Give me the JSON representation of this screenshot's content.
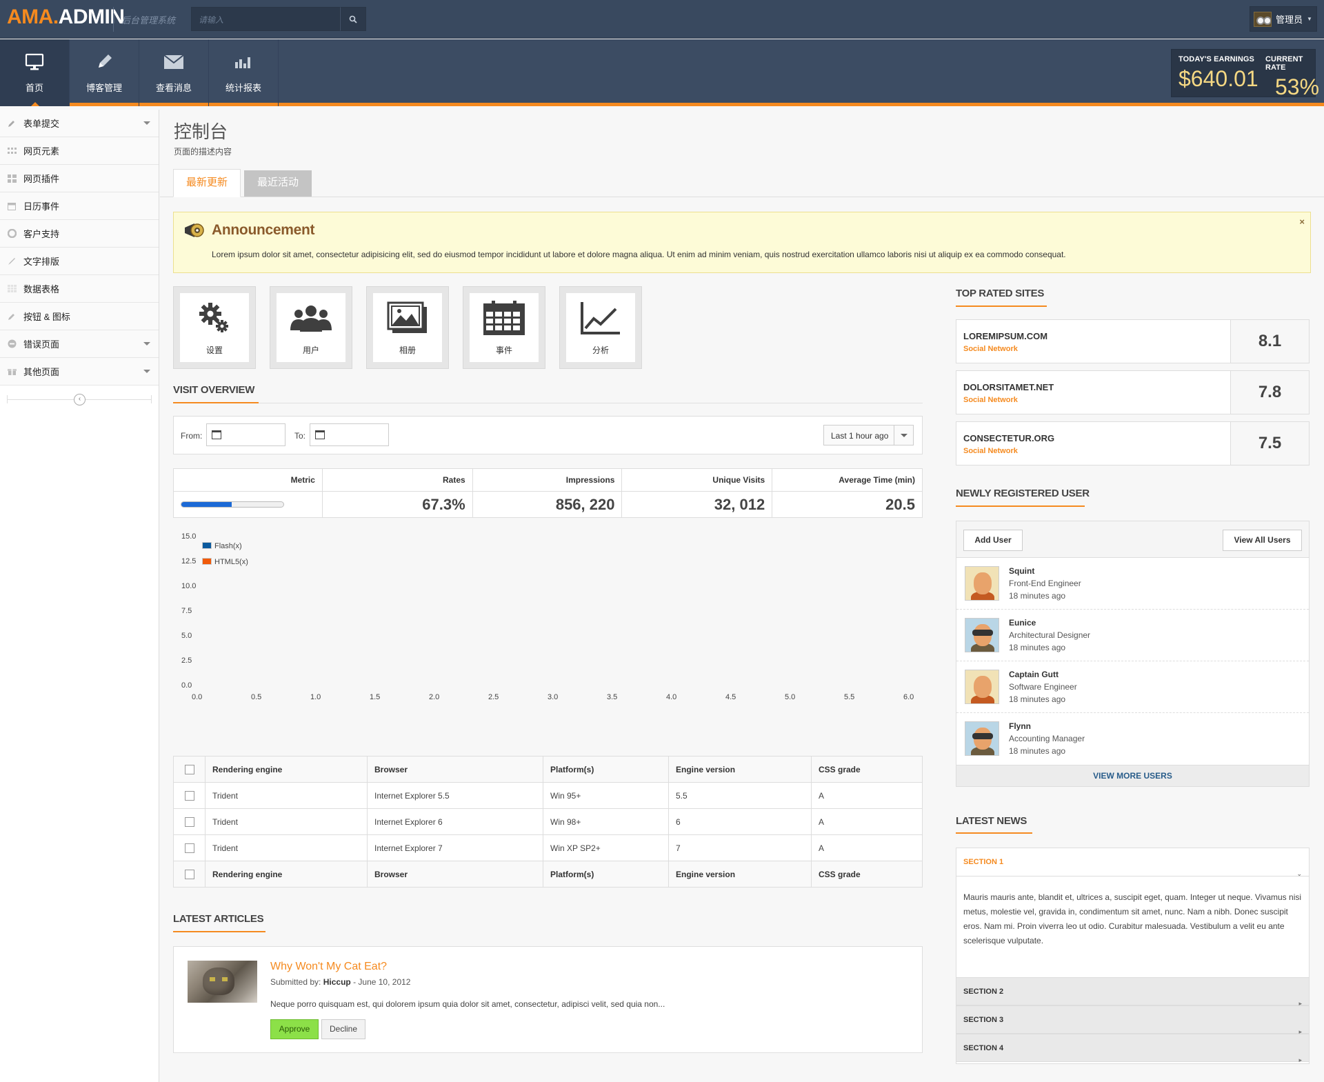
{
  "header": {
    "logo_part1": "AMA.",
    "logo_part2": "ADMIN",
    "tagline": "后台管理系统",
    "search_placeholder": "请输入",
    "user_name": "管理员"
  },
  "nav": {
    "items": [
      {
        "label": "首页",
        "icon": "monitor-icon"
      },
      {
        "label": "博客管理",
        "icon": "pencil-icon"
      },
      {
        "label": "查看消息",
        "icon": "envelope-icon"
      },
      {
        "label": "统计报表",
        "icon": "bar-chart-icon"
      }
    ],
    "earnings_label": "TODAY'S EARNINGS",
    "earnings_value": "$640.01",
    "rate_label": "CURRENT RATE",
    "rate_value": "53%"
  },
  "sidebar": {
    "items": [
      {
        "label": "表单提交",
        "icon": "pencil-icon",
        "has_submenu": true
      },
      {
        "label": "网页元素",
        "icon": "grid-icon",
        "has_submenu": false
      },
      {
        "label": "网页插件",
        "icon": "puzzle-icon",
        "has_submenu": false
      },
      {
        "label": "日历事件",
        "icon": "calendar-icon",
        "has_submenu": false
      },
      {
        "label": "客户支持",
        "icon": "lifebuoy-icon",
        "has_submenu": false
      },
      {
        "label": "文字排版",
        "icon": "brush-icon",
        "has_submenu": false
      },
      {
        "label": "数据表格",
        "icon": "table-icon",
        "has_submenu": false
      },
      {
        "label": "按钮 & 图标",
        "icon": "pencil-icon",
        "has_submenu": false
      },
      {
        "label": "错误页面",
        "icon": "minus-circle-icon",
        "has_submenu": true
      },
      {
        "label": "其他页面",
        "icon": "gift-icon",
        "has_submenu": true
      }
    ]
  },
  "page": {
    "title": "控制台",
    "description": "页面的描述内容",
    "tabs": [
      "最新更新",
      "最近活动"
    ]
  },
  "announcement": {
    "title": "Announcement",
    "text": "Lorem ipsum dolor sit amet, consectetur adipisicing elit, sed do eiusmod tempor incididunt ut labore et dolore magna aliqua. Ut enim ad minim veniam, quis nostrud exercitation ullamco laboris nisi ut aliquip ex ea commodo consequat.",
    "close": "×"
  },
  "quick_buttons": [
    {
      "label": "设置",
      "icon": "gears-icon"
    },
    {
      "label": "用户",
      "icon": "users-icon"
    },
    {
      "label": "相册",
      "icon": "picture-icon"
    },
    {
      "label": "事件",
      "icon": "calendar-icon"
    },
    {
      "label": "分析",
      "icon": "line-chart-icon"
    }
  ],
  "visit_overview": {
    "title": "VISIT OVERVIEW",
    "from_label": "From:",
    "to_label": "To:",
    "range_value": "Last 1 hour ago",
    "metric_headers": [
      "Metric",
      "Rates",
      "Impressions",
      "Unique Visits",
      "Average Time (min)"
    ],
    "metric_values": [
      "67.3%",
      "856, 220",
      "32, 012",
      "20.5"
    ],
    "metric_progress": 0.49
  },
  "chart_data": {
    "type": "line",
    "title": "",
    "xlabel": "",
    "ylabel": "",
    "xlim": [
      0,
      6
    ],
    "ylim": [
      0,
      15
    ],
    "x_ticks": [
      "0.0",
      "0.5",
      "1.0",
      "1.5",
      "2.0",
      "2.5",
      "3.0",
      "3.5",
      "4.0",
      "4.5",
      "5.0",
      "5.5",
      "6.0"
    ],
    "y_ticks": [
      "15.0",
      "12.5",
      "10.0",
      "7.5",
      "5.0",
      "2.5",
      "0.0"
    ],
    "legend_position": "top-left",
    "series": [
      {
        "name": "Flash(x)",
        "color": "#0b5a9e",
        "values": []
      },
      {
        "name": "HTML5(x)",
        "color": "#f05a0a",
        "values": []
      }
    ]
  },
  "browser_table": {
    "headers": [
      "Rendering engine",
      "Browser",
      "Platform(s)",
      "Engine version",
      "CSS grade"
    ],
    "rows": [
      [
        "Trident",
        "Internet Explorer 5.5",
        "Win 95+",
        "5.5",
        "A"
      ],
      [
        "Trident",
        "Internet Explorer 6",
        "Win 98+",
        "6",
        "A"
      ],
      [
        "Trident",
        "Internet Explorer 7",
        "Win XP SP2+",
        "7",
        "A"
      ]
    ]
  },
  "articles": {
    "title": "LATEST ARTICLES",
    "item": {
      "title": "Why Won't My Cat Eat?",
      "submitted_prefix": "Submitted by: ",
      "author": "Hiccup",
      "date": " - June 10, 2012",
      "excerpt": "Neque porro quisquam est, qui dolorem ipsum quia dolor sit amet, consectetur, adipisci velit, sed quia non...",
      "approve": "Approve",
      "decline": "Decline"
    }
  },
  "top_sites": {
    "title": "TOP RATED SITES",
    "items": [
      {
        "name": "LOREMIPSUM.COM",
        "category": "Social Network",
        "score": "8.1"
      },
      {
        "name": "DOLORSITAMET.NET",
        "category": "Social Network",
        "score": "7.8"
      },
      {
        "name": "CONSECTETUR.ORG",
        "category": "Social Network",
        "score": "7.5"
      }
    ]
  },
  "new_users": {
    "title": "NEWLY REGISTERED USER",
    "add_button": "Add User",
    "view_all_button": "View All Users",
    "more": "VIEW MORE USERS",
    "items": [
      {
        "name": "Squint",
        "role": "Front-End Engineer",
        "time": "18 minutes ago"
      },
      {
        "name": "Eunice",
        "role": "Architectural Designer",
        "time": "18 minutes ago"
      },
      {
        "name": "Captain Gutt",
        "role": "Software Engineer",
        "time": "18 minutes ago"
      },
      {
        "name": "Flynn",
        "role": "Accounting Manager",
        "time": "18 minutes ago"
      }
    ]
  },
  "latest_news": {
    "title": "LATEST NEWS",
    "sections": [
      {
        "label": "SECTION 1",
        "open": true,
        "body": "Mauris mauris ante, blandit et, ultrices a, suscipit eget, quam. Integer ut neque. Vivamus nisi metus, molestie vel, gravida in, condimentum sit amet, nunc. Nam a nibh. Donec suscipit eros. Nam mi. Proin viverra leo ut odio. Curabitur malesuada. Vestibulum a velit eu ante scelerisque vulputate."
      },
      {
        "label": "SECTION 2",
        "open": false
      },
      {
        "label": "SECTION 3",
        "open": false
      },
      {
        "label": "SECTION 4",
        "open": false
      }
    ]
  }
}
